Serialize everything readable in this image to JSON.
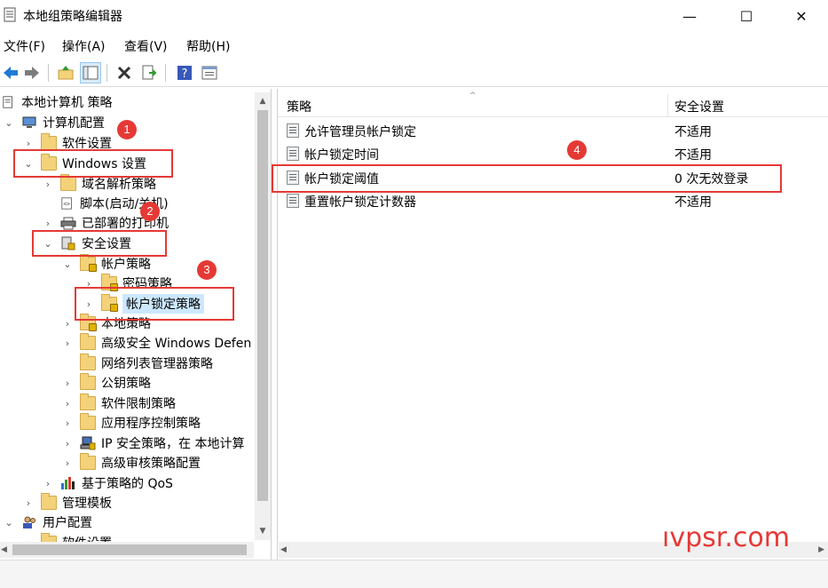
{
  "window": {
    "title": "本地组策略编辑器",
    "minimize": "—",
    "maximize": "☐",
    "close": "✕"
  },
  "menu": [
    {
      "label": "文件(F)"
    },
    {
      "label": "操作(A)"
    },
    {
      "label": "查看(V)"
    },
    {
      "label": "帮助(H)"
    }
  ],
  "toolbar": {
    "icons": [
      "back-arrow-icon",
      "forward-arrow-icon",
      "up-folder-icon",
      "show-hide-tree-icon",
      "delete-icon",
      "export-list-icon",
      "help-icon",
      "properties-icon"
    ]
  },
  "tree": {
    "root": "本地计算机 策略",
    "items": [
      {
        "label": "计算机配置"
      },
      {
        "label": "软件设置"
      },
      {
        "label": "Windows 设置"
      },
      {
        "label": "域名解析策略"
      },
      {
        "label": "脚本(启动/关机)"
      },
      {
        "label": "已部署的打印机"
      },
      {
        "label": "安全设置"
      },
      {
        "label": "帐户策略"
      },
      {
        "label": "密码策略"
      },
      {
        "label": "帐户锁定策略"
      },
      {
        "label": "本地策略"
      },
      {
        "label": "高级安全 Windows Defen"
      },
      {
        "label": "网络列表管理器策略"
      },
      {
        "label": "公钥策略"
      },
      {
        "label": "软件限制策略"
      },
      {
        "label": "应用程序控制策略"
      },
      {
        "label": "IP 安全策略，在 本地计算"
      },
      {
        "label": "高级审核策略配置"
      },
      {
        "label": "基于策略的 QoS"
      },
      {
        "label": "管理模板"
      },
      {
        "label": "用户配置"
      },
      {
        "label": "软件设置"
      }
    ]
  },
  "list": {
    "col_policy": "策略",
    "col_setting": "安全设置",
    "rows": [
      {
        "policy": "允许管理员帐户锁定",
        "setting": "不适用"
      },
      {
        "policy": "帐户锁定时间",
        "setting": "不适用"
      },
      {
        "policy": "帐户锁定阈值",
        "setting": "0 次无效登录"
      },
      {
        "policy": "重置帐户锁定计数器",
        "setting": "不适用"
      }
    ]
  },
  "annotations": {
    "badges": [
      "1",
      "2",
      "3",
      "4"
    ],
    "color": "#e53935"
  },
  "watermark": "ıvpsr.com"
}
